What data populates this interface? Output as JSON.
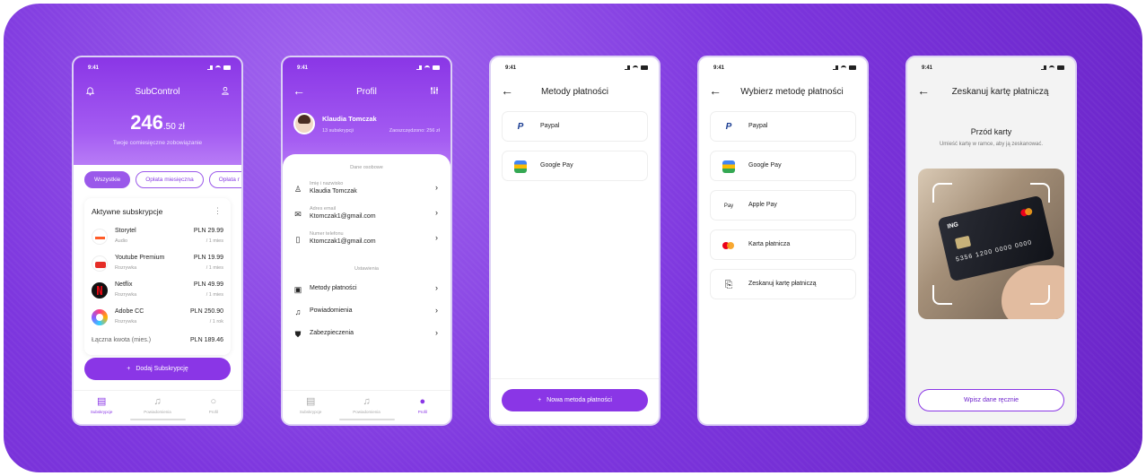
{
  "status_time": "9:41",
  "colors": {
    "accent": "#8a36e6",
    "background": "#7d36de"
  },
  "screen1": {
    "title": "SubControl",
    "amount_main": "246",
    "amount_decimal": ".50 zł",
    "amount_caption": "Twoje comiesięczne zobowiązanie",
    "filters": [
      "Wszystkie",
      "Opłata miesięczna",
      "Opłata r"
    ],
    "card_title": "Aktywne subskrypcje",
    "subscriptions": [
      {
        "name": "Storytel",
        "category": "Audio",
        "price": "PLN 29.99",
        "period": "/ 1 mies",
        "icon": "storytel-logo"
      },
      {
        "name": "Youtube Premium",
        "category": "Rozrywka",
        "price": "PLN 19.99",
        "period": "/ 1 mies",
        "icon": "youtube-logo"
      },
      {
        "name": "Netflix",
        "category": "Rozrywka",
        "price": "PLN 49.99",
        "period": "/ 1 mies",
        "icon": "netflix-logo"
      },
      {
        "name": "Adobe CC",
        "category": "Rozrywka",
        "price": "PLN 250.90",
        "period": "/ 1 rok",
        "icon": "adobe-logo"
      }
    ],
    "total_label": "Łączna kwota (mies.)",
    "total_value": "PLN 189.46",
    "add_button": "Dodaj Subskrypcję",
    "nav": [
      "Subskrypcje",
      "Powiadomienia",
      "Profil"
    ]
  },
  "screen2": {
    "title": "Profil",
    "name": "Klaudia Tomczak",
    "subs_count": "13 subskrypcji",
    "saved": "Zaoszczędzono: 256 zł",
    "section_personal": "Dane osobowe",
    "fields": [
      {
        "label": "Imię i nazwisko",
        "value": "Klaudia Tomczak",
        "icon": "person-icon"
      },
      {
        "label": "Adres email",
        "value": "Ktomczak1@gmail.com",
        "icon": "mail-icon"
      },
      {
        "label": "Numer telefonu",
        "value": "Ktomczak1@gmail.com",
        "icon": "phone-icon"
      }
    ],
    "section_settings": "Ustawienia",
    "settings": [
      {
        "label": "Metody płatności",
        "icon": "wallet-icon"
      },
      {
        "label": "Powiadomienia",
        "icon": "bell-icon"
      },
      {
        "label": "Zabezpieczenia",
        "icon": "shield-icon"
      }
    ],
    "nav": [
      "Subskrypcje",
      "Powiadomienia",
      "Profil"
    ]
  },
  "screen3": {
    "title": "Metody płatności",
    "methods": [
      "Paypal",
      "Google Pay"
    ],
    "add_button": "Nowa metoda płatności"
  },
  "screen4": {
    "title": "Wybierz metodę płatności",
    "methods": [
      "Paypal",
      "Google Pay",
      "Apple Pay",
      "Karta płatnicza",
      "Zeskanuj kartę płatniczą"
    ]
  },
  "screen5": {
    "title": "Zeskanuj kartę płatniczą",
    "heading": "Przód karty",
    "instruction": "Umieść kartę w ramce, aby ją zeskanować.",
    "card_bank": "ING",
    "card_number": "5356 1200 0000 0000",
    "manual_button": "Wpisz dane ręcznie"
  }
}
